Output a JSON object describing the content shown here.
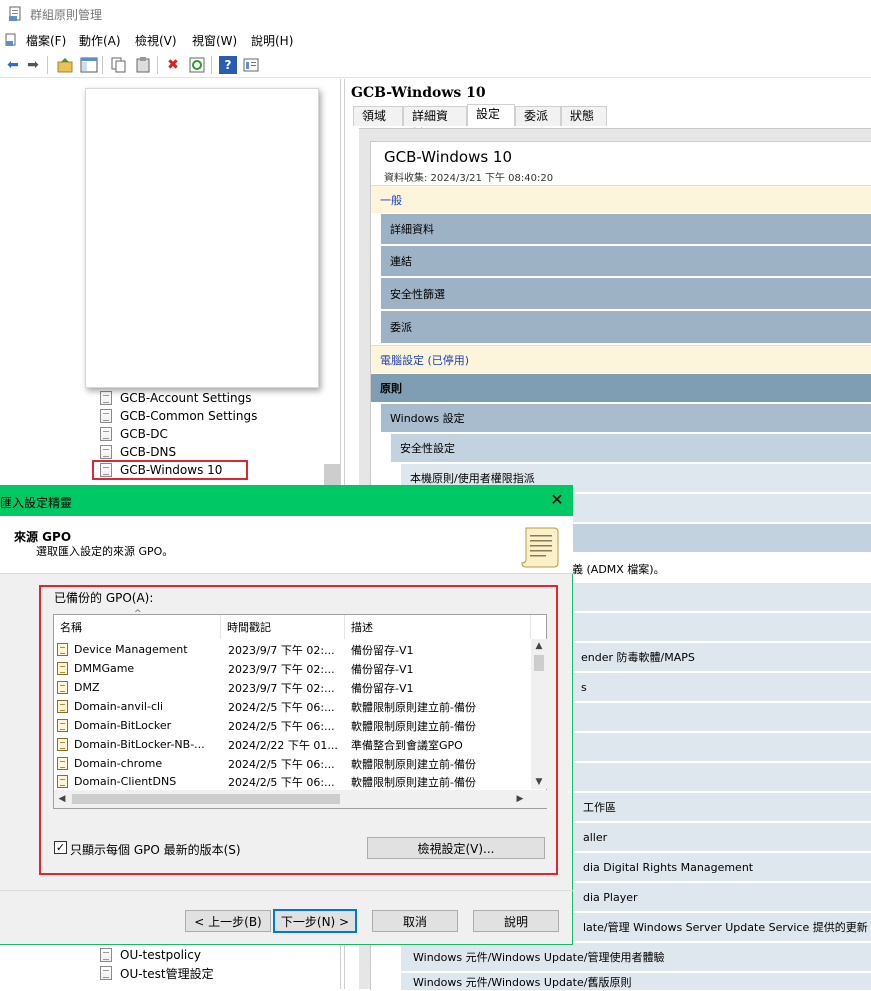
{
  "window": {
    "title": "群組原則管理"
  },
  "menu": [
    "檔案(F)",
    "動作(A)",
    "檢視(V)",
    "視窗(W)",
    "說明(H)"
  ],
  "tree": {
    "items": [
      "GCB-Account Settings",
      "GCB-Common Settings",
      "GCB-DC",
      "GCB-DNS",
      "GCB-Windows 10"
    ],
    "bottom_items": [
      "OU-testpolicy",
      "OU-test管理設定"
    ]
  },
  "right": {
    "title": "GCB-Windows 10",
    "tabs": [
      "領域",
      "詳細資料",
      "設定",
      "委派",
      "狀態"
    ],
    "report_title": "GCB-Windows 10",
    "report_sub": "資料收集: 2024/3/21 下午 08:40:20",
    "bands": {
      "general": "一般",
      "details": "詳細資料",
      "links": "連結",
      "security_filter": "安全性篩選",
      "delegation": "委派",
      "computer": "電腦設定 (已停用)",
      "policies": "原則",
      "windows_settings": "Windows 設定",
      "security_settings": "安全性設定",
      "user_rights": "本機原則/使用者權限指派"
    },
    "partial_lines": [
      "定義 (ADMX 檔案)。",
      "ender 防毒軟體/MAPS",
      "s",
      "工作區",
      "aller",
      "dia Digital Rights Management",
      "dia Player",
      "late/管理 Windows Server Update Service 提供的更新",
      "Windows 元件/Windows Update/管理使用者體驗",
      "Windows 元件/Windows Update/舊版原則"
    ]
  },
  "dialog": {
    "title": "匯入設定精靈",
    "close": "✕",
    "header_title": "來源 GPO",
    "header_sub": "選取匯入設定的來源 GPO。",
    "list_label": "已備份的 GPO(A):",
    "columns": [
      "名稱",
      "時間戳記",
      "描述"
    ],
    "rows": [
      {
        "name": "Device Management",
        "time": "2023/9/7 下午 02:...",
        "desc": "備份留存-V1"
      },
      {
        "name": "DMMGame",
        "time": "2023/9/7 下午 02:...",
        "desc": "備份留存-V1"
      },
      {
        "name": "DMZ",
        "time": "2023/9/7 下午 02:...",
        "desc": "備份留存-V1"
      },
      {
        "name": "Domain-anvil-cli",
        "time": "2024/2/5 下午 06:...",
        "desc": "軟體限制原則建立前-備份"
      },
      {
        "name": "Domain-BitLocker",
        "time": "2024/2/5 下午 06:...",
        "desc": "軟體限制原則建立前-備份"
      },
      {
        "name": "Domain-BitLocker-NB-...",
        "time": "2024/2/22 下午 01...",
        "desc": "準備整合到會議室GPO"
      },
      {
        "name": "Domain-chrome",
        "time": "2024/2/5 下午 06:...",
        "desc": "軟體限制原則建立前-備份"
      },
      {
        "name": "Domain-ClientDNS",
        "time": "2024/2/5 下午 06:...",
        "desc": "軟體限制原則建立前-備份"
      }
    ],
    "checkbox_label": "只顯示每個 GPO 最新的版本(S)",
    "checkbox_checked": true,
    "view_button": "檢視設定(V)...",
    "back_button": "< 上一步(B)",
    "next_button": "下一步(N) >",
    "cancel_button": "取消",
    "help_button": "說明"
  }
}
